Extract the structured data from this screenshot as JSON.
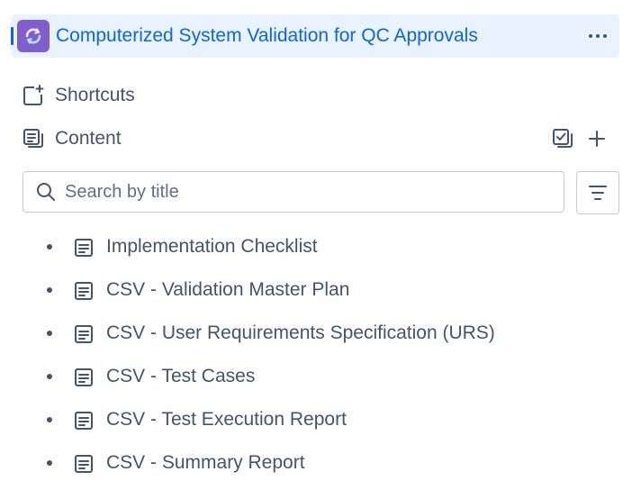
{
  "space": {
    "title": "Computerized System Validation for QC Approvals",
    "avatar_icon": "circular-arrows-icon",
    "more_icon": "more-horizontal-icon",
    "accent_color": "#0c66e4",
    "avatar_color": "#7f5fd0"
  },
  "nav": {
    "shortcuts_label": "Shortcuts",
    "content_label": "Content"
  },
  "search": {
    "placeholder": "Search by title",
    "value": ""
  },
  "tree": {
    "items": [
      {
        "label": "Implementation Checklist",
        "icon": "page-icon"
      },
      {
        "label": "CSV - Validation Master Plan",
        "icon": "page-icon"
      },
      {
        "label": "CSV - User Requirements Specification (URS)",
        "icon": "page-icon"
      },
      {
        "label": "CSV - Test Cases",
        "icon": "page-icon"
      },
      {
        "label": "CSV - Test Execution Report",
        "icon": "page-icon"
      },
      {
        "label": "CSV - Summary Report",
        "icon": "page-icon"
      }
    ]
  }
}
